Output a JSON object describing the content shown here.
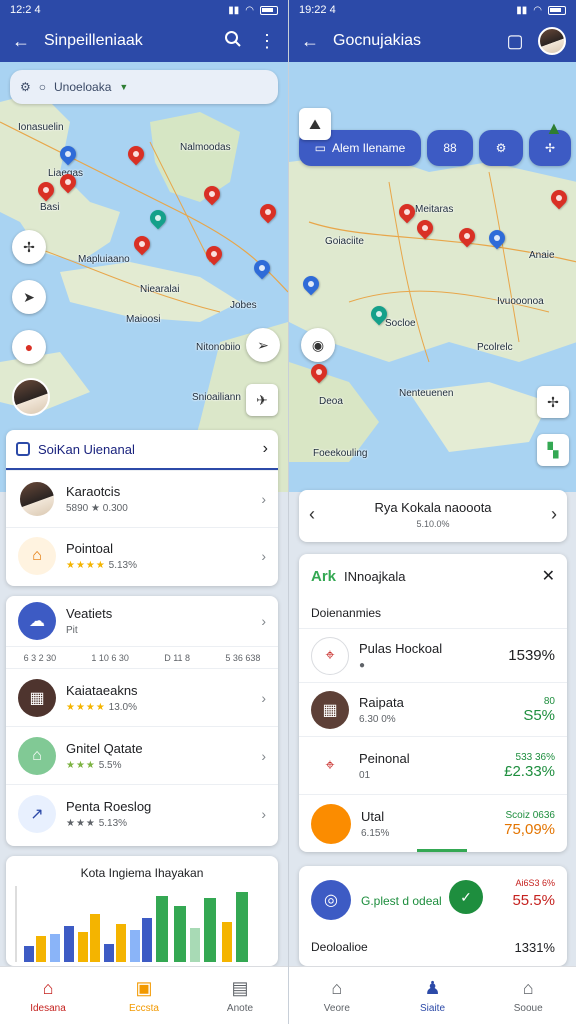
{
  "left": {
    "status": {
      "time": "12:2 4",
      "icons": "ℕ⊿"
    },
    "appbar": {
      "title": "Sinpeilleniaak"
    },
    "search": {
      "text": "Unoeloaka"
    },
    "map_labels": [
      "Ionasuelin",
      "Nalmoodas",
      "Liaegas",
      "Mapluiaano",
      "Basi",
      "Niearalai",
      "Nitonobiio",
      "Maioosi",
      "Jobes",
      "Snioailiann"
    ],
    "card1": {
      "header": "SoiKan Uienanal",
      "rows": [
        {
          "name": "Karaotcis",
          "sub": "5890 ★ 0.300"
        },
        {
          "name": "Pointoal",
          "stars": "★★★★",
          "sub": "5.13%"
        }
      ]
    },
    "card2": {
      "rows": [
        {
          "name": "Veatiets",
          "sub": "Pit"
        },
        {
          "name": "Kaiataeakns",
          "stars": "★★★★",
          "sub": "13.0%"
        },
        {
          "name": "Gnitel Qatate",
          "stars": "★★★",
          "sub": "5.5%"
        },
        {
          "name": "Penta Roeslog",
          "stars": "★★★",
          "sub": "5.13%"
        }
      ],
      "metrics": [
        "6 3 2 30",
        "1 10 6 30",
        "D 11 8",
        "5 36 638"
      ]
    },
    "chart": {
      "title": "Kota Ingiema Ihayakan"
    },
    "nav": [
      "Idesana",
      "Eccsta",
      "Anote"
    ]
  },
  "right": {
    "status": {
      "time": "19:22 4",
      "icons": "ℕ⊿"
    },
    "appbar": {
      "title": "Gocnujakias"
    },
    "chips": {
      "first": "Alem Ilename",
      "second": "88"
    },
    "map_labels": [
      "Meitaras",
      "Goiaciite",
      "Anaie",
      "Socloe",
      "Ivuooonoa",
      "Pcolrelc",
      "Nenteuenen",
      "Foeekouling",
      "Deoa"
    ],
    "location": {
      "title": "Rya Kokala naooota",
      "sub": "5.10.0%"
    },
    "detail": {
      "title": "INnoajkala",
      "section": "Doienanmies",
      "rows": [
        {
          "name": "Pulas Hockoal",
          "sub": "",
          "value": "1539%",
          "value2": ""
        },
        {
          "name": "Raipata",
          "sub": "6.30 0%",
          "value": "S5%",
          "value2": "80"
        },
        {
          "name": "Peinonal",
          "sub": "01",
          "value": "£2.33%",
          "value2": "533 36%"
        },
        {
          "name": "Utal",
          "sub": "6.15%",
          "value": "75,09%",
          "value2": "Scoiz 0636"
        }
      ]
    },
    "summary": {
      "title": "G.plest d odeal",
      "value": "55.5%",
      "value_top": "Ai6S3 6%",
      "row_label": "Deoloalioe",
      "row_value": "1331%"
    },
    "nav": [
      "Veore",
      "Siaite",
      "Sooue"
    ]
  },
  "colors": {
    "primary": "#2c4aa8",
    "accent_green": "#1e8e3e",
    "accent_orange": "#f29900",
    "pin_red": "#d93025"
  }
}
